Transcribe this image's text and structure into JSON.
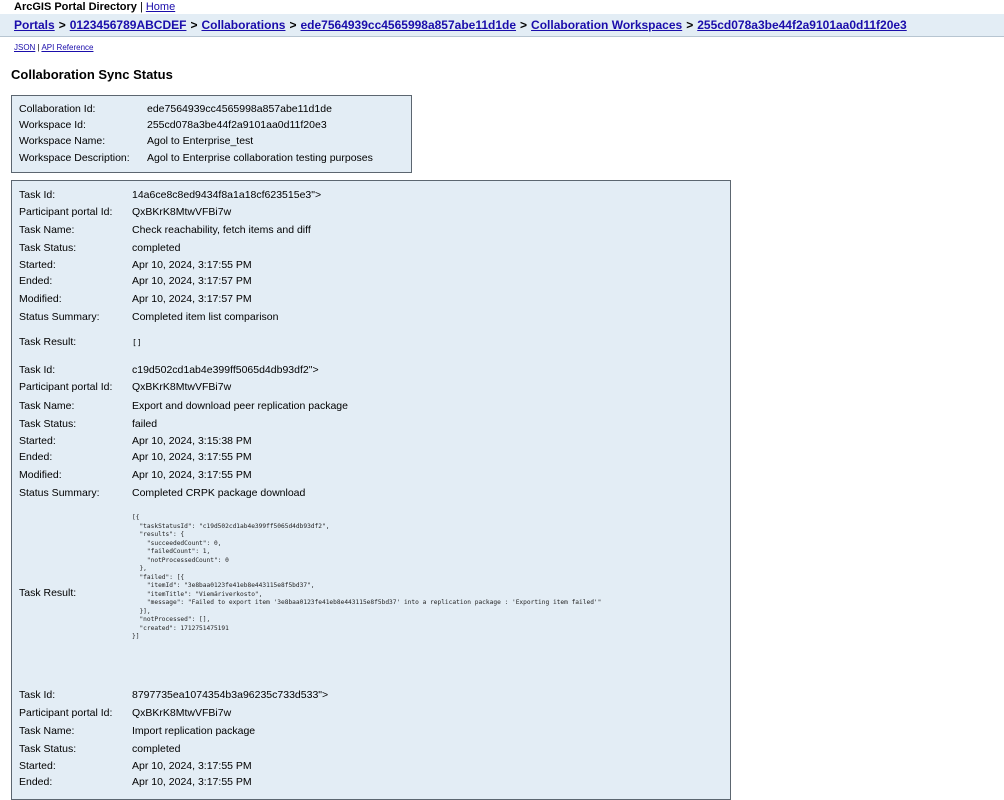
{
  "app": {
    "title": "ArcGIS Portal Directory",
    "title_sep": "|",
    "home_link": "Home"
  },
  "breadcrumb": {
    "items": [
      "Portals",
      "0123456789ABCDEF",
      "Collaborations",
      "ede7564939cc4565998a857abe11d1de",
      "Collaboration Workspaces",
      "255cd078a3be44f2a9101aa0d11f20e3"
    ],
    "separator": ">"
  },
  "links": {
    "json": "JSON",
    "sep": "|",
    "api": "API Reference"
  },
  "page_title": "Collaboration Sync Status",
  "summary": [
    {
      "label": "Collaboration Id:",
      "value": "ede7564939cc4565998a857abe11d1de"
    },
    {
      "label": "Workspace Id:",
      "value": "255cd078a3be44f2a9101aa0d11f20e3"
    },
    {
      "label": "Workspace Name:",
      "value": "Agol to Enterprise_test"
    },
    {
      "label": "Workspace Description:",
      "value": "Agol to Enterprise collaboration testing purposes"
    }
  ],
  "labels": {
    "task_id": "Task Id:",
    "participant": "Participant portal Id:",
    "task_name": "Task Name:",
    "task_status": "Task Status:",
    "started": "Started:",
    "ended": "Ended:",
    "modified": "Modified:",
    "status_summary": "Status Summary:",
    "task_result": "Task Result:"
  },
  "tasks": [
    {
      "task_id": "14a6ce8c8ed9434f8a1a18cf623515e3\">",
      "participant": "QxBKrK8MtwVFBi7w",
      "task_name": "Check reachability, fetch items and diff",
      "task_status": "completed",
      "started": "Apr 10, 2024, 3:17:55 PM",
      "ended": "Apr 10, 2024, 3:17:57 PM",
      "modified": "Apr 10, 2024, 3:17:57 PM",
      "status_summary": "Completed item list comparison",
      "task_result": "[]"
    },
    {
      "task_id": "c19d502cd1ab4e399ff5065d4db93df2\">",
      "participant": "QxBKrK8MtwVFBi7w",
      "task_name": "Export and download peer replication package",
      "task_status": "failed",
      "started": "Apr 10, 2024, 3:15:38 PM",
      "ended": "Apr 10, 2024, 3:17:55 PM",
      "modified": "Apr 10, 2024, 3:17:55 PM",
      "status_summary": "Completed CRPK package download",
      "task_result": "[{\n  \"taskStatusId\": \"c19d502cd1ab4e399ff5065d4db93df2\",\n  \"results\": {\n    \"succeededCount\": 0,\n    \"failedCount\": 1,\n    \"notProcessedCount\": 0\n  },\n  \"failed\": [{\n    \"itemId\": \"3e8baa0123fe41eb8e443115e8f5bd37\",\n    \"itemTitle\": \"Viemäriverkosto\",\n    \"message\": \"Failed to export item '3e8baa0123fe41eb8e443115e8f5bd37' into a replication package : 'Exporting item failed'\"\n  }],\n  \"notProcessed\": [],\n  \"created\": 1712751475191\n}]"
    },
    {
      "task_id": "8797735ea1074354b3a96235c733d533\">",
      "participant": "QxBKrK8MtwVFBi7w",
      "task_name": "Import replication package",
      "task_status": "completed",
      "started": "Apr 10, 2024, 3:17:55 PM",
      "ended": "Apr 10, 2024, 3:17:55 PM"
    }
  ]
}
